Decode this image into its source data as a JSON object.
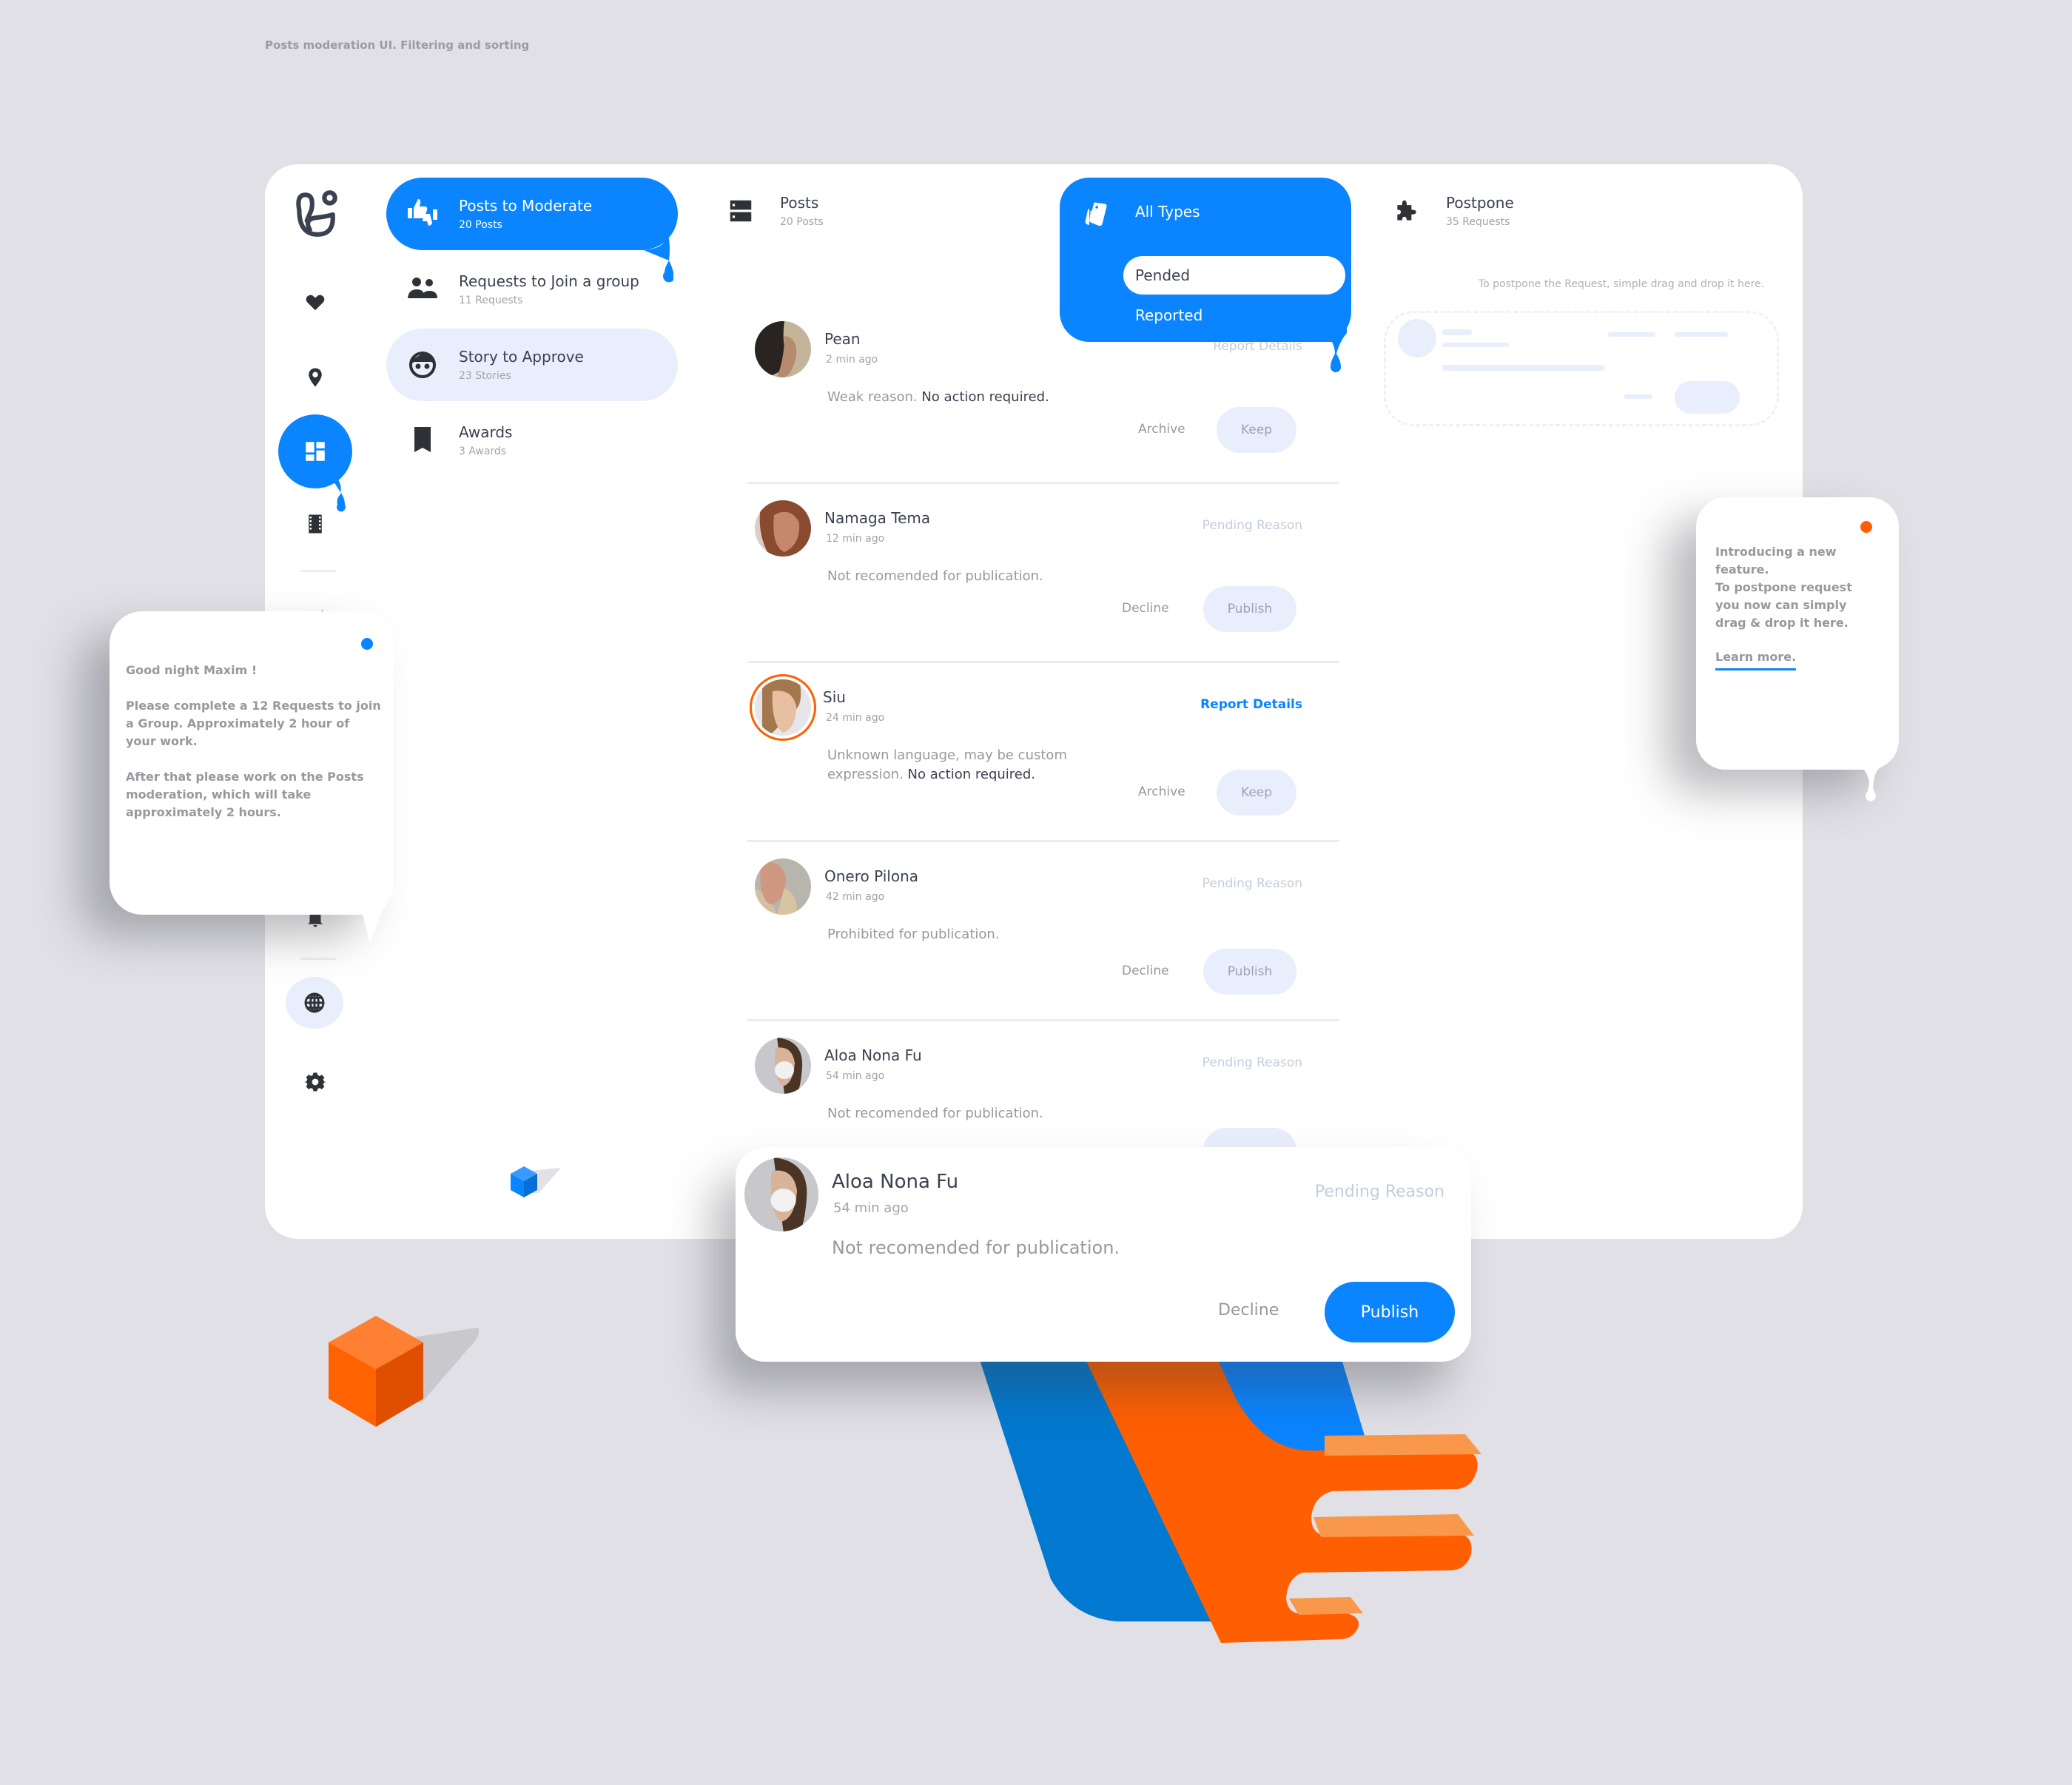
{
  "page_caption": "Posts moderation UI. Filtering and sorting",
  "colors": {
    "accent": "#0a84ff",
    "accent_soft": "#e8eefb",
    "orange": "#ff5f00",
    "background": "#e0e0e6"
  },
  "sidebar": {
    "icons": [
      "logo-icon",
      "heart-icon",
      "location-pin-icon",
      "dashboard-icon",
      "film-icon",
      "pencil-icon",
      "bell-icon",
      "globe-icon",
      "gear-icon"
    ],
    "active": "dashboard-icon"
  },
  "nav": {
    "items": [
      {
        "title": "Posts to Moderate",
        "sub": "20 Posts",
        "icon": "thumbs-up-down-icon",
        "state": "active"
      },
      {
        "title": "Requests to Join a group",
        "sub": "11 Requests",
        "icon": "people-icon",
        "state": "default"
      },
      {
        "title": "Story to Approve",
        "sub": "23 Stories",
        "icon": "face-icon",
        "state": "hover"
      },
      {
        "title": "Awards",
        "sub": "3 Awards",
        "icon": "bookmark-icon",
        "state": "default"
      }
    ]
  },
  "posts_column": {
    "title": "Posts",
    "sub": "20 Posts"
  },
  "type_filter": {
    "label": "All Types",
    "options": [
      {
        "label": "Pended",
        "selected": true
      },
      {
        "label": "Reported",
        "selected": false
      }
    ]
  },
  "posts": [
    {
      "name": "Pean",
      "time": "2 min ago",
      "link": "Report Details",
      "link_style": "muted",
      "msg": "Weak reason.",
      "msg_strong": " No action required.",
      "secondary": "Archive",
      "primary": "Keep",
      "ringed": false
    },
    {
      "name": "Namaga Tema",
      "time": "12 min ago",
      "link": "Pending Reason",
      "link_style": "muted",
      "msg": "Not recomended for publication.",
      "msg_strong": "",
      "secondary": "Decline",
      "primary": "Publish",
      "ringed": false
    },
    {
      "name": "Siu",
      "time": "24 min ago",
      "link": "Report Details",
      "link_style": "blue",
      "msg": "Unknown language, may be custom expression.",
      "msg_strong": " No action required.",
      "secondary": "Archive",
      "primary": "Keep",
      "ringed": true
    },
    {
      "name": "Onero Pilona",
      "time": "42 min ago",
      "link": "Pending Reason",
      "link_style": "muted",
      "msg": "Prohibited for publication.",
      "msg_strong": "",
      "secondary": "Decline",
      "primary": "Publish",
      "ringed": false
    },
    {
      "name": "Aloa Nona Fu",
      "time": "54 min ago",
      "link": "Pending Reason",
      "link_style": "muted",
      "msg": "Not recomended for publication.",
      "msg_strong": "",
      "secondary": "",
      "primary": "",
      "ringed": false
    }
  ],
  "postpone": {
    "title": "Postpone",
    "sub": "35 Requests",
    "hint": "To postpone the Request, simple drag and drop it here."
  },
  "tip_left": {
    "greeting": "Good night Maxim !",
    "para1": "Please complete a 12 Requests to join a Group. Approximately 2 hour of your work.",
    "para2": "After that please work on the Posts moderation, which will take approximately 2 hours."
  },
  "tip_right": {
    "title": "Introducing a new feature.",
    "body": "To postpone request you now can simply drag & drop it here.",
    "link": "Learn more."
  },
  "dragged_card": {
    "name": "Aloa Nona Fu",
    "time": "54 min ago",
    "link": "Pending Reason",
    "msg": "Not recomended for publication.",
    "secondary": "Decline",
    "primary": "Publish"
  }
}
